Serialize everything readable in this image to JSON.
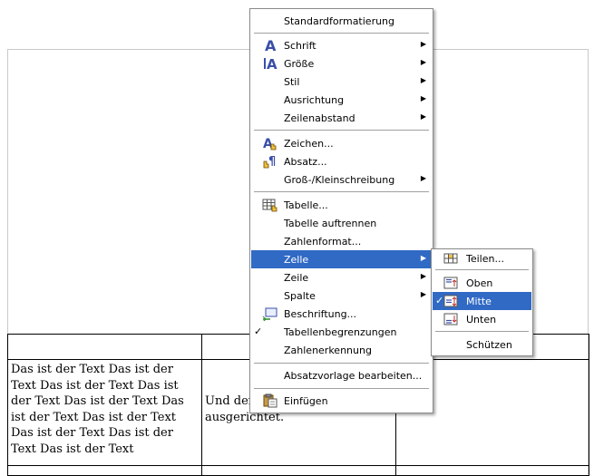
{
  "document": {
    "col1_text": "Das ist der Text Das ist der Text Das ist der Text Das ist der Text Das ist der Text Das ist der Text Das ist der Text Das ist der Text Das ist der Text Das ist der Text",
    "col2_text": "Und der Text wurde mittig ausgerichtet."
  },
  "context_menu": {
    "standardformatierung": "Standardformatierung",
    "schrift": "Schrift",
    "groesse": "Größe",
    "stil": "Stil",
    "ausrichtung": "Ausrichtung",
    "zeilenabstand": "Zeilenabstand",
    "zeichen": "Zeichen...",
    "absatz": "Absatz...",
    "gross_klein": "Groß-/Kleinschreibung",
    "tabelle": "Tabelle...",
    "tabelle_auftrennen": "Tabelle auftrennen",
    "zahlenformat": "Zahlenformat...",
    "zelle": "Zelle",
    "zeile": "Zeile",
    "spalte": "Spalte",
    "beschriftung": "Beschriftung...",
    "tabellenbegrenzungen": "Tabellenbegrenzungen",
    "zahlenerkennung": "Zahlenerkennung",
    "absatzvorlage": "Absatzvorlage bearbeiten...",
    "einfuegen": "Einfügen"
  },
  "submenu": {
    "teilen": "Teilen...",
    "oben": "Oben",
    "mitte": "Mitte",
    "unten": "Unten",
    "schuetzen": "Schützen"
  },
  "colors": {
    "highlight": "#316ac5",
    "icon_blue": "#3a4fa8"
  }
}
